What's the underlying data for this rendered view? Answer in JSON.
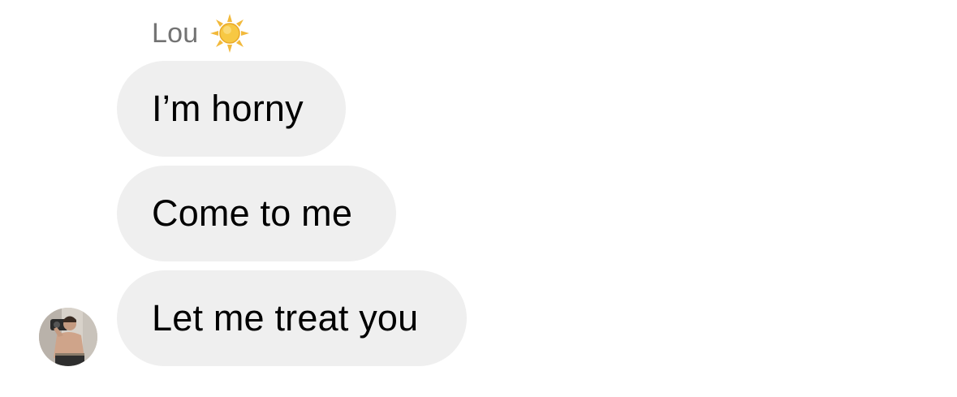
{
  "sender": {
    "name": "Lou",
    "emoji_icon": "sun-icon"
  },
  "messages": [
    {
      "text": "I’m horny"
    },
    {
      "text": "Come to me"
    },
    {
      "text": "Let me treat you"
    }
  ],
  "colors": {
    "bubble_background": "#efefef",
    "sender_name": "#737373",
    "message_text": "#000000",
    "background": "#ffffff"
  },
  "avatar": {
    "icon": "profile-photo"
  }
}
